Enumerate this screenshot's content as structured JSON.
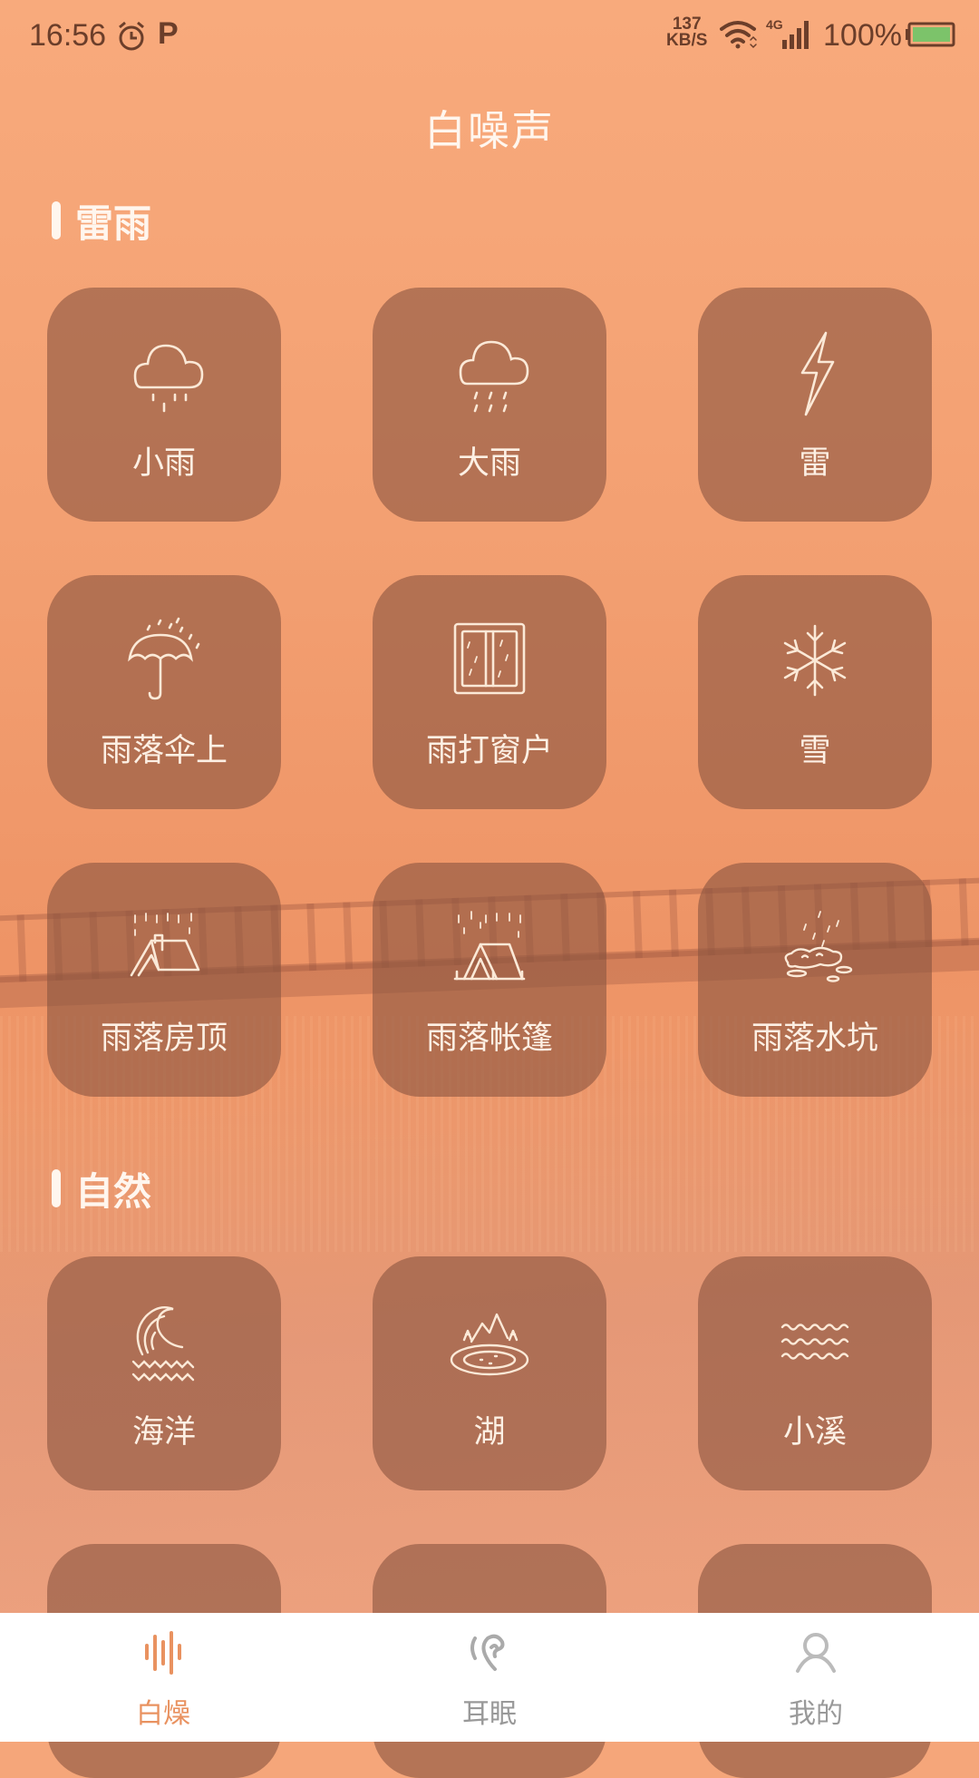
{
  "status_bar": {
    "time": "16:56",
    "alarm_icon": "alarm-clock-icon",
    "notification_icon": "p-app-icon",
    "net_speed_value": "137",
    "net_speed_unit": "KB/S",
    "wifi_icon": "wifi-icon",
    "network_type": "4G",
    "battery_percent": "100%",
    "battery_level": 1.0
  },
  "header": {
    "title": "白噪声"
  },
  "colors": {
    "accent": "#E99260",
    "background": "#F5A67A",
    "card": "#8C5541",
    "text_light": "#FFF6EE",
    "tab_inactive": "#999999"
  },
  "sections": [
    {
      "title": "雷雨",
      "items": [
        {
          "label": "小雨",
          "icon": "light-rain-cloud-icon"
        },
        {
          "label": "大雨",
          "icon": "heavy-rain-cloud-icon"
        },
        {
          "label": "雷",
          "icon": "lightning-bolt-icon"
        },
        {
          "label": "雨落伞上",
          "icon": "umbrella-rain-icon"
        },
        {
          "label": "雨打窗户",
          "icon": "window-rain-icon"
        },
        {
          "label": "雪",
          "icon": "snowflake-icon"
        },
        {
          "label": "雨落房顶",
          "icon": "roof-rain-icon"
        },
        {
          "label": "雨落帐篷",
          "icon": "tent-rain-icon"
        },
        {
          "label": "雨落水坑",
          "icon": "puddle-rain-icon"
        }
      ]
    },
    {
      "title": "自然",
      "items": [
        {
          "label": "海洋",
          "icon": "ocean-wave-icon"
        },
        {
          "label": "湖",
          "icon": "lake-mountain-icon"
        },
        {
          "label": "小溪",
          "icon": "stream-waves-icon"
        },
        {
          "label": "",
          "icon": "mountain-icon"
        },
        {
          "label": "",
          "icon": "bird-leaf-icon"
        },
        {
          "label": "",
          "icon": "nature-partial-icon"
        }
      ]
    }
  ],
  "tab_bar": {
    "items": [
      {
        "label": "白燥",
        "icon": "sound-wave-icon",
        "active": true
      },
      {
        "label": "耳眠",
        "icon": "ear-icon",
        "active": false
      },
      {
        "label": "我的",
        "icon": "user-profile-icon",
        "active": false
      }
    ]
  }
}
